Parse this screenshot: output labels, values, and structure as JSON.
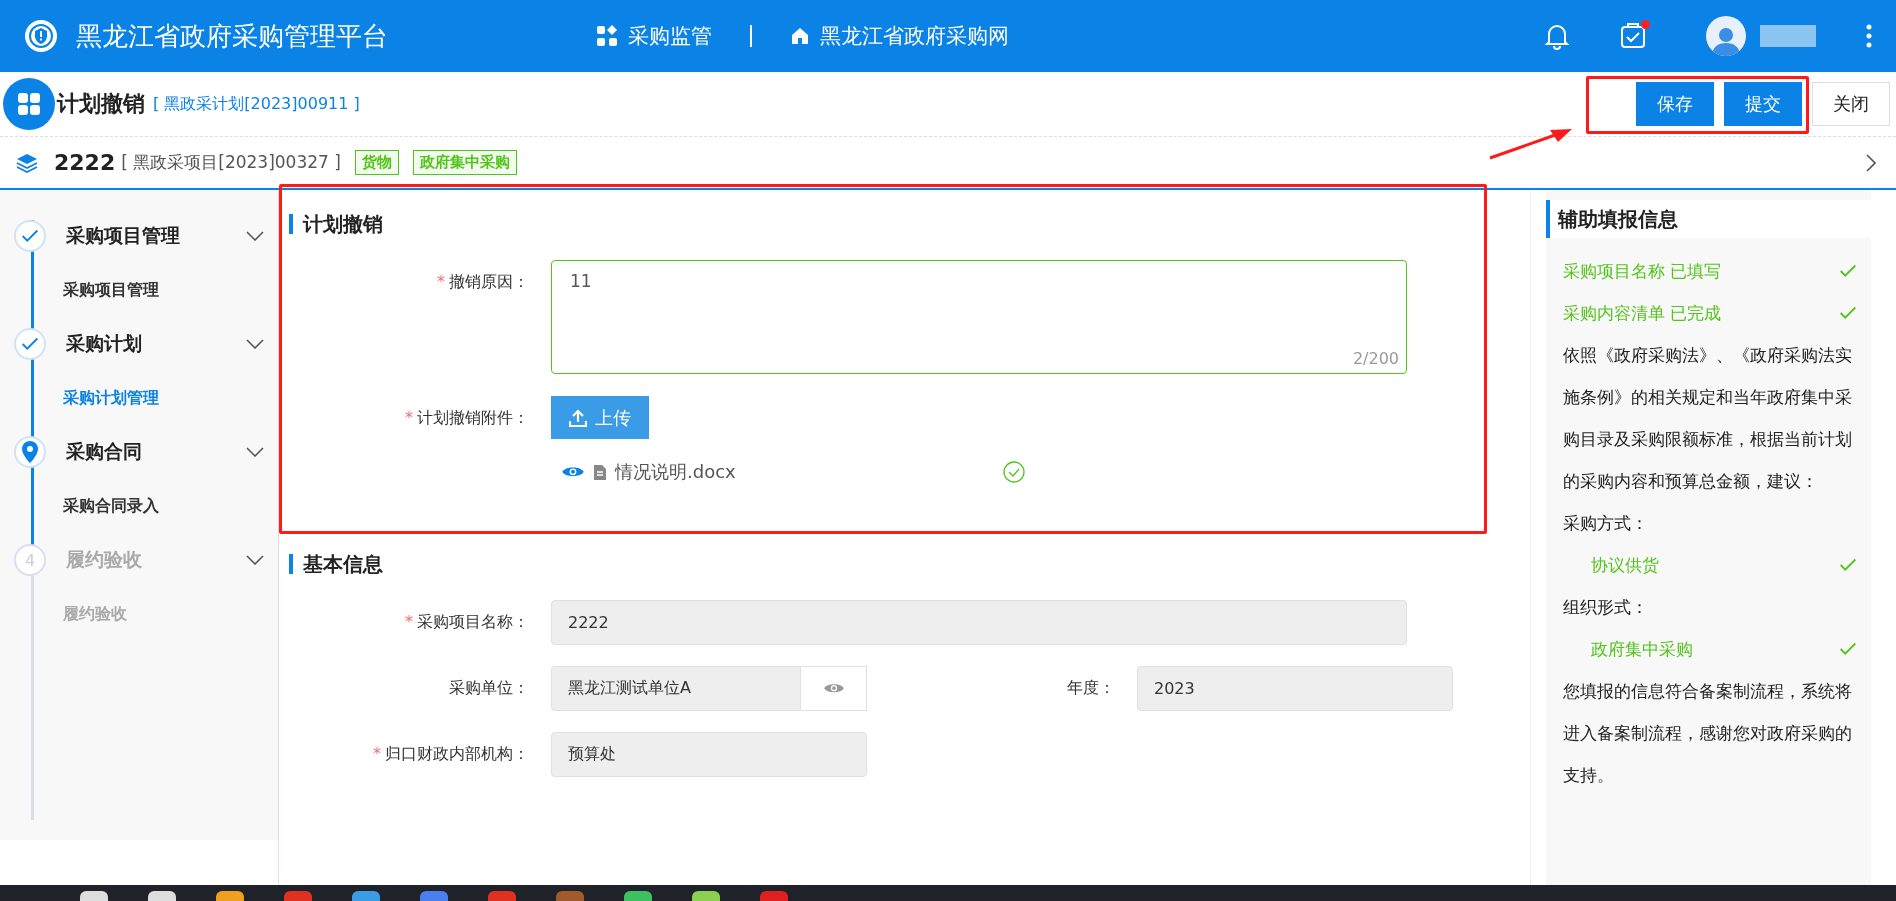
{
  "header": {
    "title": "黑龙江省政府采购管理平台",
    "nav": [
      {
        "label": "采购监管"
      },
      {
        "label": "黑龙江省政府采购网"
      }
    ],
    "todo_badge": true
  },
  "page": {
    "title": "计划撤销",
    "code": "[ 黑政采计划[2023]00911 ]",
    "buttons": [
      {
        "label": "保存",
        "kind": "primary"
      },
      {
        "label": "提交",
        "kind": "primary"
      },
      {
        "label": "关闭",
        "kind": "default"
      }
    ]
  },
  "project": {
    "name": "2222",
    "code": "[ 黑政采项目[2023]00327 ]",
    "tags": [
      "货物",
      "政府集中采购"
    ]
  },
  "steps": [
    {
      "title": "采购项目管理",
      "kind": "done",
      "children": [
        {
          "label": "采购项目管理",
          "selected": false
        }
      ]
    },
    {
      "title": "采购计划",
      "kind": "done",
      "children": [
        {
          "label": "采购计划管理",
          "selected": true
        }
      ]
    },
    {
      "title": "采购合同",
      "kind": "current",
      "children": [
        {
          "label": "采购合同录入",
          "selected": false
        }
      ]
    },
    {
      "title": "履约验收",
      "kind": "pending",
      "number": "4",
      "children": [
        {
          "label": "履约验收",
          "selected": false
        }
      ]
    }
  ],
  "cancel": {
    "title": "计划撤销",
    "reason": {
      "label": "撤销原因：",
      "mark": "*",
      "value": "11",
      "count": "2/200"
    },
    "attachment": {
      "label": "计划撤销附件：",
      "mark": "*",
      "button": "上传",
      "files": [
        {
          "name": "情况说明.docx",
          "uploaded": true
        }
      ]
    }
  },
  "basic": {
    "title": "基本信息",
    "rows": [
      [
        {
          "kind": "wide",
          "label": "采购项目名称：",
          "mark": "*",
          "value": "2222"
        }
      ],
      [
        {
          "kind": "lookup",
          "label": "采购单位：",
          "value": "黑龙江测试单位A"
        },
        {
          "kind": "plain",
          "label": "年度：",
          "value": "2023"
        }
      ],
      [
        {
          "kind": "plain",
          "label": "归口财政内部机构：",
          "mark": "*",
          "value": "预算处"
        }
      ]
    ]
  },
  "helper": {
    "title": "辅助填报信息",
    "items": [
      {
        "kind": "check",
        "text": "采购项目名称 已填写"
      },
      {
        "kind": "check",
        "text": "采购内容清单 已完成"
      },
      {
        "kind": "paragraph",
        "text": "依照《政府采购法》、《政府采购法实施条例》的相关规定和当年政府集中采购目录及采购限额标准，根据当前计划的采购内容和预算总金额，建议："
      },
      {
        "kind": "paragraph",
        "text": "采购方式："
      },
      {
        "kind": "option",
        "text": "协议供货"
      },
      {
        "kind": "paragraph",
        "text": "组织形式："
      },
      {
        "kind": "option",
        "text": "政府集中采购"
      },
      {
        "kind": "paragraph",
        "text": "您填报的信息符合备案制流程，系统将进入备案制流程，感谢您对政府采购的支持。"
      }
    ]
  }
}
